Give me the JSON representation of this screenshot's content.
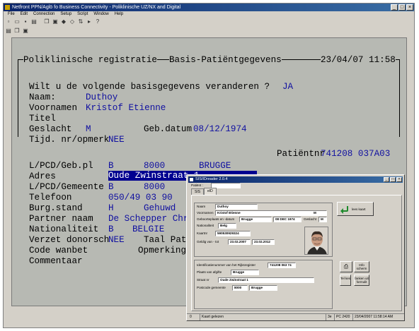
{
  "window": {
    "title": "Netfront PPN/Aglö fo Business Connectivity - Poliklinische UZ/NX and Digital",
    "menu": [
      "File",
      "Edit",
      "Connection",
      "Setup",
      "Script",
      "Window",
      "Help"
    ]
  },
  "terminal": {
    "header_left": "Poliklinische registratie",
    "header_center": "Basis-Patiëntgegevens",
    "header_right": "23/04/07 11:58",
    "question": "Wilt u de volgende basisgegevens veranderen ?",
    "question_answer": "JA",
    "naam_label": "Naam:",
    "naam_value": "Duthoy",
    "voornamen_label": "Voornamen",
    "voornamen_value": "Kristof Etienne",
    "titel_label": "Titel",
    "geslacht_label": "Geslacht",
    "geslacht_value": "M",
    "gebdatum_label": "Geb.datum",
    "gebdatum_value": "08/12/1974",
    "tijd_label": "Tijd. nr/opmerk",
    "tijd_value": "NEE",
    "patientnr_label": "Patiëntnr",
    "patientnr_value": "741208 037A03",
    "lpcd_gebpl_label": "L/PCD/Geb.pl",
    "lpcd_gebpl_land": "B",
    "lpcd_gebpl_pc": "8000",
    "lpcd_gebpl_city": "BRUGGE",
    "adres_label": "Adres",
    "adres_value": "Oude Zwinstraat 1",
    "lpcd_gem_label": "L/PCD/Gemeente",
    "lpcd_gem_land": "B",
    "lpcd_gem_pc": "8000",
    "telefoon_label": "Telefoon",
    "telefoon_value": "050/49 03 90",
    "burg_label": "Burg.stand",
    "burg_code": "H",
    "burg_value": "Gehuwd",
    "partner_label": "Partner naam",
    "partner_value": "De Schepper Chris",
    "nationaliteit_label": "Nationaliteit",
    "nationaliteit_code": "B",
    "nationaliteit_value": "BELGIE",
    "verzet_label": "Verzet donorsch",
    "verzet_value": "NEE",
    "taal_label": "Taal Patië",
    "code_label": "Code wanbet",
    "opmerking_label": "Opmerking",
    "commentaar_label": "Commentaar"
  },
  "dialog": {
    "title": "SIS/IDreader 2.0.4",
    "patient_label": "Patiënt :",
    "tabs": [
      "SIS",
      "eID"
    ],
    "naam_label": "Naam",
    "naam_value": "Duthoy",
    "voornamen_label": "Voornamen",
    "voornamen_value": "Kristof Etienne",
    "geslacht_code": "M",
    "geboorte_label": "Geboorteplaats en -datum",
    "geboorte_plaats": "Brugge",
    "geboorte_datum": "08 DEC 1974",
    "geslacht_label": "Geslacht",
    "geslacht_value": "M",
    "nationaliteit_label": "Nationaliteit",
    "nationaliteit_value": "Belg",
    "kaartnr_label": "Kaartnr",
    "kaartnr_value": "590530929324",
    "geldig_label": "Geldig van - tot",
    "geldig_van": "23.02.2007",
    "geldig_tot": "23.02.2012",
    "rijksregister_label": "Identificatienummer van het Rijksregister",
    "rijksregister_value": "741208 063 74",
    "plaats_label": "Plaats van afgifte",
    "plaats_value": "Brugge",
    "straat_label": "Straat nr",
    "straat_value": "Oude Zwinstraat 1",
    "postcode_label": "Postcode gemeente",
    "postcode_value": "8000",
    "gemeente_value": "Brugge",
    "lees_button": "lees kaart",
    "info_button": "Info scherm",
    "tel_button": "Tel kes",
    "ferm_button": "fanken uit formulit",
    "status_left": "0",
    "status_center": "Kaart gelezen",
    "status_right_a": "3e",
    "status_right_b": "PC 2420",
    "status_right_c": "23/04/2007 11:58:14 AM"
  }
}
